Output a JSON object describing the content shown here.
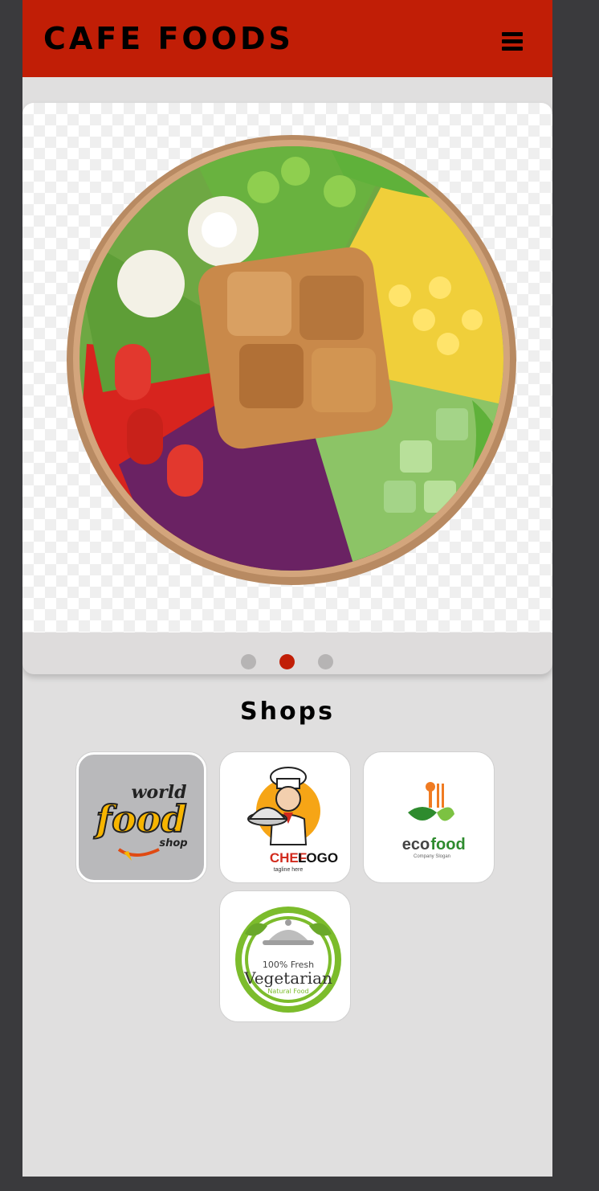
{
  "app": {
    "title": "CAFE FOODS"
  },
  "header": {
    "menu_icon": "hamburger-menu-icon"
  },
  "carousel": {
    "slide_count": 3,
    "active_index": 1,
    "image": "salad-bowl-image"
  },
  "shops": {
    "title": "Shops",
    "selected_index": 0,
    "items": [
      {
        "logo": "world-food-shop-logo",
        "l1": "world",
        "l2": "food",
        "l3": "shop"
      },
      {
        "logo": "chef-logo",
        "l1": "CHEF",
        "l2": "LOGO",
        "l3": "tagline here"
      },
      {
        "logo": "eco-food-logo",
        "l1": "eco",
        "l2": "food",
        "l3": "Company Slogan"
      },
      {
        "logo": "vegetarian-logo",
        "l1": "100% Fresh",
        "l2": "Vegetarian",
        "l3": "Natural Food"
      }
    ]
  },
  "colors": {
    "brand": "#c11e06",
    "background": "#e0dfdf",
    "frame": "#3a3a3d"
  }
}
